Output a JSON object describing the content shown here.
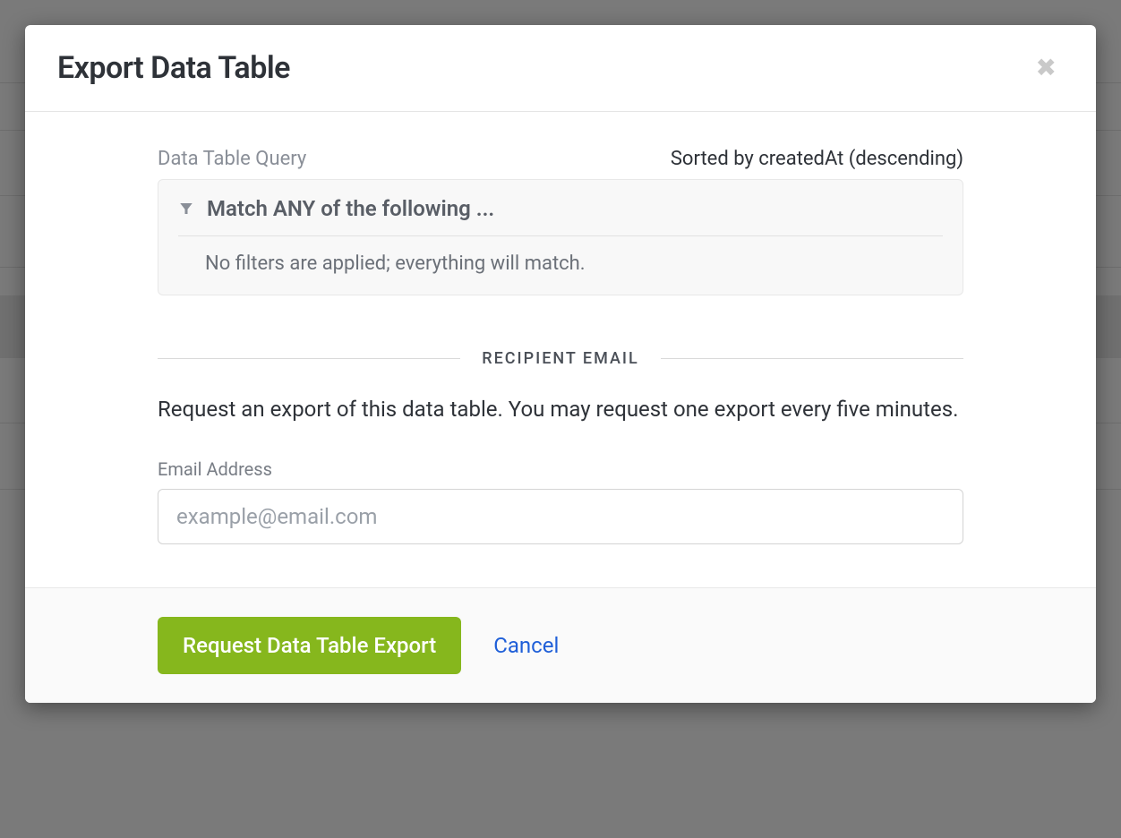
{
  "modal": {
    "title": "Export Data Table",
    "close_glyph": "✖"
  },
  "query": {
    "label": "Data Table Query",
    "sort_text": "Sorted by createdAt (descending)",
    "match_text": "Match ANY of the following ...",
    "status_text": "No filters are applied; everything will match."
  },
  "section": {
    "divider_label": "RECIPIENT EMAIL",
    "description": "Request an export of this data table. You may request one export every five minutes."
  },
  "form": {
    "email_label": "Email Address",
    "email_placeholder": "example@email.com",
    "email_value": ""
  },
  "footer": {
    "submit_label": "Request Data Table Export",
    "cancel_label": "Cancel"
  }
}
